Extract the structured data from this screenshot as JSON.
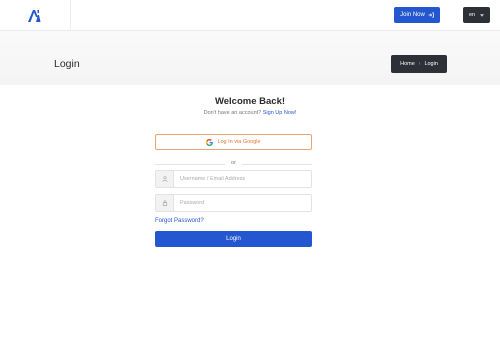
{
  "header": {
    "logo_icon": "brand-logo",
    "join_label": "Join Now",
    "join_icon": "sign-in-icon",
    "lang_label": "en",
    "lang_icon": "chevron-down-icon"
  },
  "page": {
    "title": "Login",
    "breadcrumb": [
      "Home",
      "Login"
    ]
  },
  "form": {
    "welcome": "Welcome Back!",
    "no_account_text": "Don't have an account?",
    "signup_link": "Sign Up Now!",
    "google_label": "Log In via Google",
    "or_text": "or",
    "username_placeholder": "Username / Email Address",
    "password_placeholder": "Password",
    "forgot_link": "Forgot Password?",
    "login_label": "Login"
  },
  "colors": {
    "primary": "#2457cf",
    "dark": "#2d3036",
    "google_border": "#f0a46a"
  }
}
